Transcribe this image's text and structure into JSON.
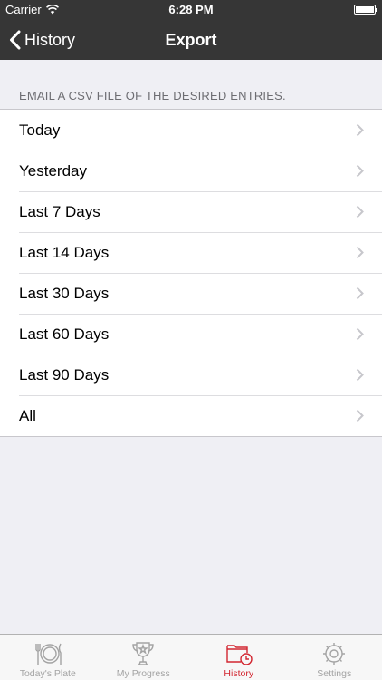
{
  "status_bar": {
    "carrier": "Carrier",
    "time": "6:28 PM"
  },
  "nav": {
    "back_label": "History",
    "title": "Export"
  },
  "section": {
    "header": "EMAIL A CSV FILE OF THE DESIRED ENTRIES.",
    "items": [
      {
        "label": "Today"
      },
      {
        "label": "Yesterday"
      },
      {
        "label": "Last 7 Days"
      },
      {
        "label": "Last 14 Days"
      },
      {
        "label": "Last 30 Days"
      },
      {
        "label": "Last 60 Days"
      },
      {
        "label": "Last 90 Days"
      },
      {
        "label": "All"
      }
    ]
  },
  "tabbar": {
    "active": "History",
    "tabs": [
      {
        "label": "Today's Plate",
        "icon": "plate-icon"
      },
      {
        "label": "My Progress",
        "icon": "trophy-icon"
      },
      {
        "label": "History",
        "icon": "folder-clock-icon"
      },
      {
        "label": "Settings",
        "icon": "gear-icon"
      }
    ]
  },
  "colors": {
    "nav_bg": "#363636",
    "accent": "#d22630",
    "inactive": "#a3a3a3",
    "background": "#efeff4"
  }
}
